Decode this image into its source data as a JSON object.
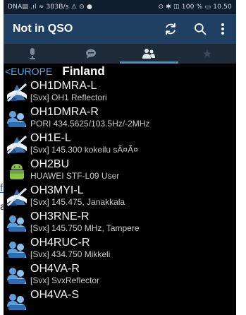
{
  "background": {
    "link_fragment": "fi",
    "text_fragment": "a"
  },
  "status_bar": {
    "left_text": "DNA▤ .ıl ≈ 383B/s  ⚠ ⊙ ●",
    "right_text": "⊙ ✱ ◫ 100 % ▭ 10.50"
  },
  "app_bar": {
    "title": "Not in QSO",
    "actions": [
      "refresh-icon",
      "search-icon",
      "overflow-menu-icon"
    ]
  },
  "tabs": [
    {
      "icon": "microphone-icon",
      "selected": false
    },
    {
      "icon": "chat-icon",
      "selected": false
    },
    {
      "icon": "users-icon",
      "selected": true
    },
    {
      "icon": "star-icon",
      "selected": false
    }
  ],
  "breadcrumb": {
    "back_label": "<EUROPE",
    "title": "Finland"
  },
  "stations": [
    {
      "callsign": "OH1DMRA-L",
      "description": "[Svx] OH1 Reflectori",
      "icon": "link-node-icon"
    },
    {
      "callsign": "OH1DMRA-R",
      "description": "PORI 434.5625/103.5Hz/-2MHz",
      "icon": "repeater-icon"
    },
    {
      "callsign": "OH1E-L",
      "description": "[Svx] 145.300 kokeilu sÃ¤Ã¤",
      "icon": "link-node-icon"
    },
    {
      "callsign": "OH2BU",
      "description": "HUAWEI STF-L09 User",
      "icon": "android-user-icon"
    },
    {
      "callsign": "OH3MYI-L",
      "description": "[Svx] 145.475, Janakkala",
      "icon": "link-node-icon"
    },
    {
      "callsign": "OH3RNE-R",
      "description": "[Svx] 145.750 MHz, Tampere",
      "icon": "repeater-icon"
    },
    {
      "callsign": "OH4RUC-R",
      "description": "[Svx] 434.750 Mikkeli",
      "icon": "repeater-icon"
    },
    {
      "callsign": "OH4VA-R",
      "description": "[Svx] SvxReflector",
      "icon": "repeater-icon"
    },
    {
      "callsign": "OH4VA-S",
      "description": "",
      "icon": "repeater-icon"
    }
  ],
  "colors": {
    "app_bar": "#1f4063",
    "tab_bar": "#1e2b38",
    "tab_indicator": "#3f93d8",
    "breadcrumb_link": "#4ba6e6",
    "list_background": "#000000"
  }
}
